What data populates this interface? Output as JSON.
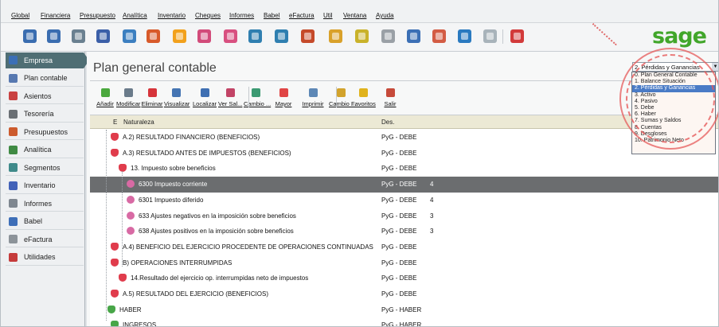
{
  "menu": [
    "Global",
    "Financiera",
    "Presupuesto",
    "Analítica",
    "Inventario",
    "Cheques",
    "Informes",
    "Babel",
    "eFactura",
    "Util",
    "Ventana",
    "Ayuda"
  ],
  "brand": "sage",
  "toolbar_icons": [
    "clients-icon",
    "suppliers-icon",
    "ledger-icon",
    "calculator-icon",
    "globe-icon",
    "report-icon",
    "check-icon",
    "letter-icon",
    "mail-icon",
    "folder-icon",
    "folder-icon",
    "tools-icon",
    "box-icon",
    "box-icon",
    "globe2-icon",
    "search-icon",
    "calendar-icon",
    "world-icon",
    "card-icon",
    "exit-icon"
  ],
  "sidebar": [
    {
      "label": "Empresa",
      "icon": "company-icon",
      "active": true,
      "color": "#3b6fb6"
    },
    {
      "label": "Plan contable",
      "icon": "plan-icon",
      "color": "#5778b0"
    },
    {
      "label": "Asientos",
      "icon": "entries-icon",
      "color": "#c94141"
    },
    {
      "label": "Tesorería",
      "icon": "treasury-icon",
      "color": "#6a6f74"
    },
    {
      "label": "Presupuestos",
      "icon": "budget-icon",
      "color": "#cc5b2e"
    },
    {
      "label": "Analítica",
      "icon": "analytics-icon",
      "color": "#3f8a43"
    },
    {
      "label": "Segmentos",
      "icon": "segments-icon",
      "color": "#3f8a8a"
    },
    {
      "label": "Inventario",
      "icon": "inventory-icon",
      "color": "#4262b8"
    },
    {
      "label": "Informes",
      "icon": "reports-icon",
      "color": "#7f8790"
    },
    {
      "label": "Babel",
      "icon": "babel-icon",
      "color": "#3e6fb8"
    },
    {
      "label": "eFactura",
      "icon": "efactura-icon",
      "color": "#8c9399"
    },
    {
      "label": "Utilidades",
      "icon": "utilities-icon",
      "color": "#c53b3b"
    }
  ],
  "page": {
    "title": "Plan general contable"
  },
  "actions": [
    {
      "label": "Añadir",
      "icon": "add-icon",
      "color": "#4aa83d"
    },
    {
      "label": "Modificar",
      "icon": "edit-icon",
      "color": "#6a7b8a"
    },
    {
      "label": "Eliminar",
      "icon": "delete-icon",
      "color": "#d6343a"
    },
    {
      "label": "Visualizar",
      "icon": "view-icon",
      "color": "#4575b3"
    },
    {
      "label": "Localizar",
      "icon": "find-icon",
      "color": "#3e6fb2"
    },
    {
      "label": "Ver Sal...",
      "icon": "balance-icon",
      "color": "#c24466"
    },
    {
      "label": "Cambio ...",
      "icon": "change-icon",
      "color": "#3c9a72"
    },
    {
      "label": "Mayor",
      "icon": "ledger-book-icon",
      "color": "#e04545"
    },
    {
      "label": "Imprimir",
      "icon": "print-icon",
      "color": "#5d88b6"
    },
    {
      "label": "Cambio ...",
      "icon": "change2-icon",
      "color": "#d2a32c"
    },
    {
      "label": "Favoritos",
      "icon": "star-icon",
      "color": "#e0b31d"
    },
    {
      "label": "Salir",
      "icon": "exit-icon",
      "color": "#c64a3a"
    }
  ],
  "grid": {
    "headers": {
      "e": "E",
      "naturaleza": "Naturaleza",
      "des": "Des."
    },
    "rows": [
      {
        "name": "A.2) RESULTADO FINANCIERO (BENEFICIOS)",
        "des": "PyG - DEBE",
        "level": "",
        "indent": 0,
        "icon": "red"
      },
      {
        "name": "A.3) RESULTADO ANTES DE IMPUESTOS (BENEFICIOS)",
        "des": "PyG - DEBE",
        "level": "",
        "indent": 0,
        "icon": "red"
      },
      {
        "name": "13. Impuesto sobre beneficios",
        "des": "PyG - DEBE",
        "level": "",
        "indent": 1,
        "icon": "red"
      },
      {
        "name": "6300  Impuesto corriente",
        "des": "PyG - DEBE",
        "level": "4",
        "indent": 2,
        "icon": "pink",
        "selected": true
      },
      {
        "name": "6301  Impuesto diferido",
        "des": "PyG - DEBE",
        "level": "4",
        "indent": 2,
        "icon": "pink"
      },
      {
        "name": "633  Ajustes negativos en la imposición sobre beneficios",
        "des": "PyG - DEBE",
        "level": "3",
        "indent": 2,
        "icon": "pink"
      },
      {
        "name": "638  Ajustes positivos en la imposición sobre beneficios",
        "des": "PyG - DEBE",
        "level": "3",
        "indent": 2,
        "icon": "pink"
      },
      {
        "name": "A.4) BENEFICIO DEL EJERCICIO PROCEDENTE DE OPERACIONES CONTINUADAS",
        "des": "PyG - DEBE",
        "level": "",
        "indent": 0,
        "icon": "red"
      },
      {
        "name": "B) OPERACIONES INTERRUMPIDAS",
        "des": "PyG - DEBE",
        "level": "",
        "indent": 0,
        "icon": "red"
      },
      {
        "name": "14.Resultado del ejercicio op. interrumpidas neto de impuestos",
        "des": "PyG - DEBE",
        "level": "",
        "indent": 1,
        "icon": "red"
      },
      {
        "name": "A.5) RESULTADO DEL EJERCICIO (BENEFICIOS)",
        "des": "PyG - DEBE",
        "level": "",
        "indent": 0,
        "icon": "red"
      },
      {
        "name": "HABER",
        "des": "PyG - HABER",
        "level": "",
        "indent": -1,
        "icon": "grn"
      },
      {
        "name": "INGRESOS",
        "des": "PyG - HABER",
        "level": "",
        "indent": 0,
        "icon": "grn"
      }
    ]
  },
  "combo": {
    "value": "2. Pérdidas y Ganancias"
  },
  "dropdown": [
    {
      "label": "0. Plan General Contable"
    },
    {
      "label": "1. Balance Situación"
    },
    {
      "label": "2. Pérdidas y Ganancias",
      "selected": true
    },
    {
      "label": "3. Activo"
    },
    {
      "label": "4. Pasivo"
    },
    {
      "label": "5. Debe"
    },
    {
      "label": "6. Haber"
    },
    {
      "label": "7. Sumas y Saldos"
    },
    {
      "label": "8. Cuentas"
    },
    {
      "label": "9. Desgloses"
    },
    {
      "label": "10. Patrimonio Neto"
    }
  ]
}
